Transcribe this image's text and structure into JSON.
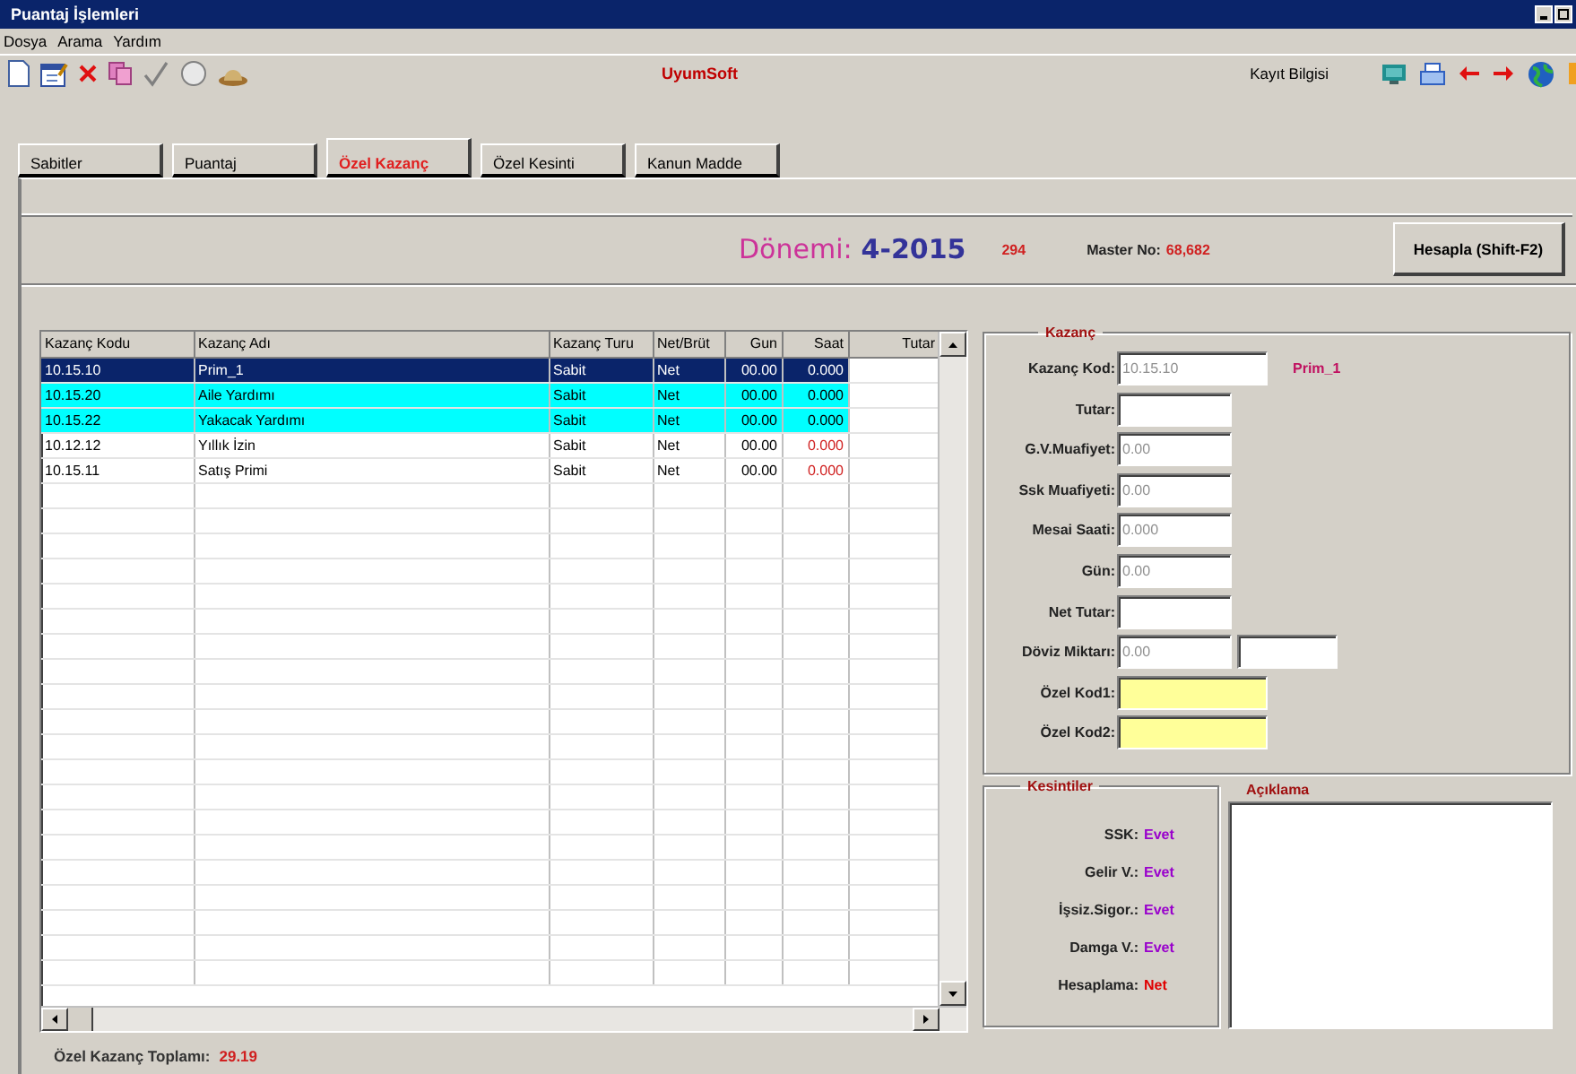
{
  "window": {
    "title": "Puantaj İşlemleri"
  },
  "menu": [
    "Dosya",
    "Arama",
    "Yardım"
  ],
  "toolbar": {
    "brand": "UyumSoft",
    "record_info": "Kayıt Bilgisi"
  },
  "tabs": [
    {
      "label": "Sabitler",
      "selected": false
    },
    {
      "label": "Puantaj",
      "selected": false
    },
    {
      "label": "Özel Kazanç",
      "selected": true
    },
    {
      "label": "Özel Kesinti",
      "selected": false
    },
    {
      "label": "Kanun Madde",
      "selected": false
    }
  ],
  "header": {
    "period_label": "Dönemi:",
    "period": "4-2015",
    "count": "294",
    "master_label": "Master No:",
    "master_no": "68,682",
    "button": "Hesapla (Shift-F2)"
  },
  "table": {
    "columns": [
      "Kazanç Kodu",
      "Kazanç Adı",
      "Kazanç Turu",
      "Net/Brüt",
      "Gun",
      "Saat",
      "Tutar"
    ],
    "rows": [
      {
        "cells": [
          "10.15.10",
          "Prim_1",
          "Sabit",
          "Net",
          "00.00",
          "0.000"
        ],
        "selected": true,
        "marked": false
      },
      {
        "cells": [
          "10.15.20",
          "Aile Yardımı",
          "Sabit",
          "Net",
          "00.00",
          "0.000"
        ],
        "selected": false,
        "marked": true
      },
      {
        "cells": [
          "10.15.22",
          "Yakacak Yardımı",
          "Sabit",
          "Net",
          "00.00",
          "0.000"
        ],
        "selected": false,
        "marked": true
      },
      {
        "cells": [
          "10.12.12",
          "Yıllık İzin",
          "Sabit",
          "Net",
          "00.00",
          "0.000"
        ],
        "selected": false,
        "marked": false
      },
      {
        "cells": [
          "10.15.11",
          "Satış Primi",
          "Sabit",
          "Net",
          "00.00",
          "0.000"
        ],
        "selected": false,
        "marked": false
      }
    ]
  },
  "total": {
    "label": "Özel Kazanç Toplamı:",
    "value": "29.19"
  },
  "earning": {
    "title": "Kazanç",
    "fields": [
      {
        "label": "Kazanç Kod:",
        "value": "10.15.10",
        "note": "Prim_1",
        "disabled": true,
        "kind": "lookup"
      },
      {
        "label": "Tutar:",
        "kind": "text"
      },
      {
        "label": "G.V.Muafiyet:",
        "value": "0.00",
        "disabled": true,
        "kind": "text"
      },
      {
        "label": "Ssk Muafiyeti:",
        "value": "0.00",
        "disabled": true,
        "kind": "text"
      },
      {
        "label": "Mesai Saati:",
        "value": "0.000",
        "disabled": true,
        "kind": "text"
      },
      {
        "label": "Gün:",
        "value": "0.00",
        "disabled": true,
        "kind": "text"
      },
      {
        "label": "Net Tutar:",
        "kind": "text"
      },
      {
        "label": "Döviz Miktarı:",
        "value": "0.00",
        "disabled": true,
        "kind": "pair"
      },
      {
        "label": "Özel Kod1:",
        "kind": "code"
      },
      {
        "label": "Özel Kod2:",
        "kind": "code"
      }
    ]
  },
  "deductions": {
    "title": "Kesintiler",
    "items": [
      {
        "label": "SSK:",
        "value": "Evet",
        "color": "#9900cc"
      },
      {
        "label": "Gelir V.:",
        "value": "Evet",
        "color": "#9900cc"
      },
      {
        "label": "İşsiz.Sigor.:",
        "value": "Evet",
        "color": "#9900cc"
      },
      {
        "label": "Damga V.:",
        "value": "Evet",
        "color": "#9900cc"
      },
      {
        "label": "Hesaplama:",
        "value": "Net",
        "color": "#e00000"
      }
    ]
  },
  "description": {
    "title": "Açıklama"
  }
}
